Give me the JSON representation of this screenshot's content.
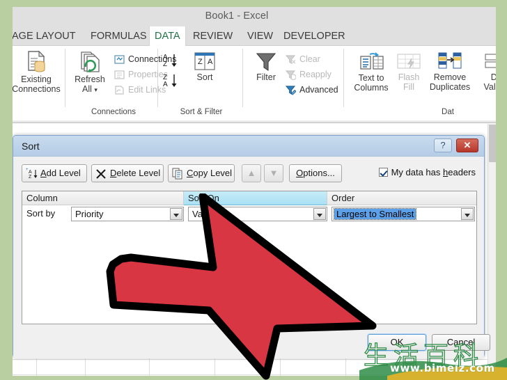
{
  "window": {
    "title": "Book1 - Excel"
  },
  "ribbon": {
    "tabs": [
      {
        "label": "AGE LAYOUT",
        "active": false
      },
      {
        "label": "FORMULAS",
        "active": false
      },
      {
        "label": "DATA",
        "active": true
      },
      {
        "label": "REVIEW",
        "active": false
      },
      {
        "label": "VIEW",
        "active": false
      },
      {
        "label": "DEVELOPER",
        "active": false
      }
    ],
    "groups": [
      {
        "label": "Connections"
      },
      {
        "label": "Sort & Filter"
      },
      {
        "label": "Dat"
      }
    ],
    "buttons": {
      "existing_connections_line1": "Existing",
      "existing_connections_line2": "Connections",
      "refresh_all_line1": "Refresh",
      "refresh_all_line2": "All",
      "connections": "Connections",
      "properties": "Properties",
      "edit_links": "Edit Links",
      "sort_az": "A↓Z",
      "sort_za": "Z↓A",
      "sort": "Sort",
      "filter": "Filter",
      "clear": "Clear",
      "reapply": "Reapply",
      "advanced": "Advanced",
      "text_to_columns_line1": "Text to",
      "text_to_columns_line2": "Columns",
      "flash_fill_line1": "Flash",
      "flash_fill_line2": "Fill",
      "remove_duplicates_line1": "Remove",
      "remove_duplicates_line2": "Duplicates",
      "data_validation_line1": "Data",
      "data_validation_line2": "Validatio"
    }
  },
  "dialog": {
    "title": "Sort",
    "help_glyph": "?",
    "close_glyph": "✕",
    "toolbar": {
      "add_level": "Add Level",
      "delete_level": "Delete Level",
      "copy_level": "Copy Level",
      "move_up_glyph": "▲",
      "move_down_glyph": "▼",
      "options": "Options...",
      "headers_checkbox_label": "My data has headers",
      "headers_checked": true
    },
    "columns": [
      "Column",
      "Sort On",
      "Order"
    ],
    "selected_column_header": "Sort On",
    "row": {
      "sort_by_label": "Sort by",
      "column_value": "Priority",
      "sort_on_value": "Value",
      "order_value": "Largest to Smallest",
      "order_selected": true
    },
    "footer": {
      "ok": "OK",
      "cancel": "Cancel"
    }
  },
  "annotation": {
    "arrow_color": "#d93644",
    "arrow_outline": "#000000",
    "arrow_points_to": "OK"
  },
  "watermark": {
    "characters": "生活百科",
    "url": "www.bimeiz.com",
    "color": "#2f8c46"
  },
  "colors": {
    "page_background": "#b9cfa1",
    "ribbon_background": "#e0e0e0",
    "active_tab": "#217346",
    "dialog_titlebar": "#c0d6ea",
    "selection_blue": "#5ba0e8",
    "header_selected": "#a8e0f3"
  }
}
